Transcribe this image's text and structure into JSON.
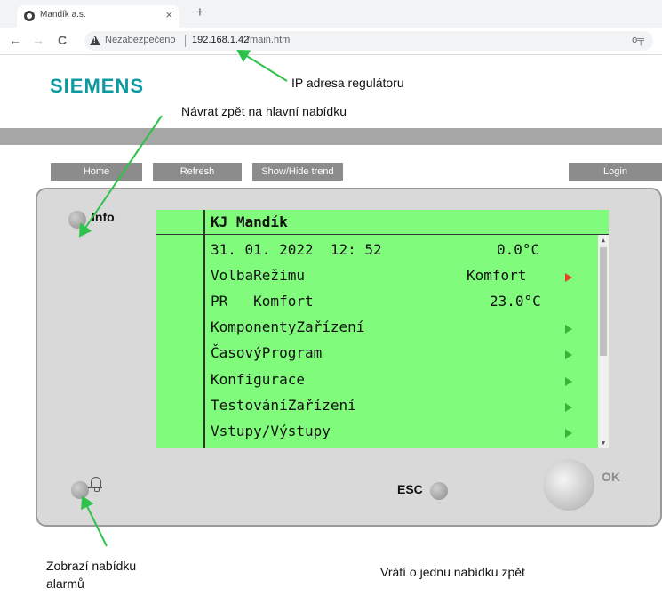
{
  "browser": {
    "tab_title": "Mandík a.s.",
    "tab_close": "×",
    "new_tab": "+",
    "back": "←",
    "forward": "→",
    "reload": "C",
    "security_label": "Nezabezpečeno",
    "url_host": "192.168.1.42",
    "url_path": "/main.htm",
    "key_icon": "o╤"
  },
  "brand": "SIEMENS",
  "buttons": {
    "home": "Home",
    "refresh": "Refresh",
    "show_hide_trend": "Show/Hide trend",
    "login": "Login"
  },
  "device": {
    "info_label": "Info",
    "esc_label": "ESC",
    "ok_label": "OK"
  },
  "lcd": {
    "title": "KJ Mandík",
    "rows": [
      {
        "label": "31. 01. 2022  12: 52",
        "value": "0.0°C",
        "arrow": "none"
      },
      {
        "label": "VolbaRežimu",
        "value": "Komfort",
        "arrow": "red"
      },
      {
        "label": "PR   Komfort",
        "value": "23.0°C",
        "arrow": "none"
      },
      {
        "label": "KomponentyZařízení",
        "value": "",
        "arrow": "green"
      },
      {
        "label": "ČasovýProgram",
        "value": "",
        "arrow": "green"
      },
      {
        "label": "Konfigurace",
        "value": "",
        "arrow": "green"
      },
      {
        "label": "TestováníZařízení",
        "value": "",
        "arrow": "green"
      },
      {
        "label": "Vstupy/Výstupy",
        "value": "",
        "arrow": "green"
      }
    ],
    "scroll_up": "▲",
    "scroll_down": "▼"
  },
  "annotations": {
    "ip_address": "IP adresa regulátoru",
    "return_main": "Návrat zpět na hlavní nabídku",
    "show_alarms_line1": "Zobrazí nabídku",
    "show_alarms_line2": "alarmů",
    "go_back_one": "Vrátí o jednu nabídku zpět"
  },
  "colors": {
    "lcd_background": "#80fb7c",
    "logo": "#0a9aa0",
    "annotation_arrow": "#2ec24a",
    "menu_arrow": "#3db23a",
    "selected_arrow": "#e8402a"
  }
}
